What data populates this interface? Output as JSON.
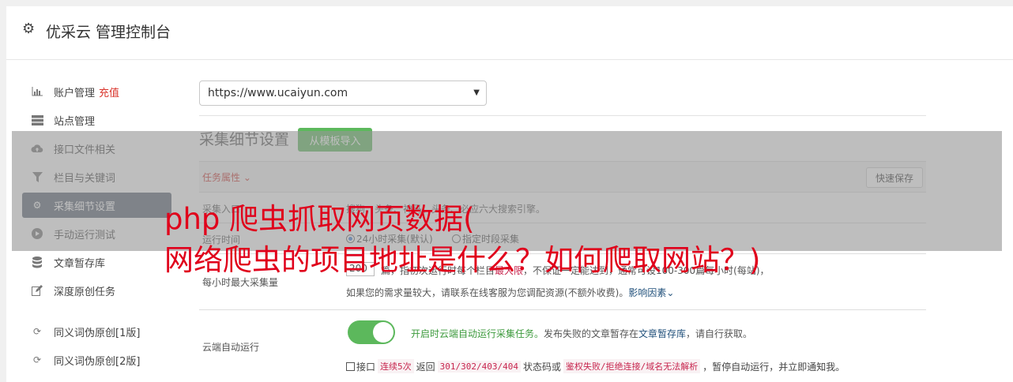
{
  "header": {
    "title": "优采云 管理控制台",
    "icon": "gear-icon"
  },
  "sidebar": {
    "items": [
      {
        "label": "账户管理",
        "badge": "充值",
        "icon": "bar-chart-icon"
      },
      {
        "label": "站点管理",
        "icon": "server-icon"
      },
      {
        "label": "接口文件相关",
        "icon": "cloud-upload-icon"
      },
      {
        "label": "栏目与关键词",
        "icon": "filter-icon"
      },
      {
        "label": "采集细节设置",
        "icon": "gears-icon",
        "active": true
      },
      {
        "label": "手动运行测试",
        "icon": "play-circle-icon"
      },
      {
        "label": "文章暂存库",
        "icon": "database-icon"
      },
      {
        "label": "深度原创任务",
        "icon": "edit-icon"
      },
      {
        "label": "同义词伪原创[1版]",
        "icon": "refresh-icon"
      },
      {
        "label": "同义词伪原创[2版]",
        "icon": "refresh-icon"
      }
    ]
  },
  "site_select": {
    "value": "https://www.ucaiyun.com"
  },
  "section": {
    "title": "采集细节设置",
    "template_button": "从模板导入"
  },
  "table": {
    "attr_label": "任务属性",
    "quick_save": "快速保存",
    "entry_label": "采集入口",
    "entry_value": "搜狗、头条、神马、头条、必应六大搜索引擎。",
    "time_label": "运行时间",
    "time_option_1": "24小时采集(默认)",
    "time_option_2": "指定时段采集",
    "max_label": "每小时最大采集量",
    "max_value": "200",
    "max_text_a": "篇，指初次运行时每个栏目",
    "max_text_pink": "最大限",
    "max_text_b": "，不保证一定能达到，通常可设100-300篇每小时(每站)，",
    "max_text_2": "如果您的需求量较大，请联系在线客服为您调配资源(不额外收费)。",
    "max_link": "影响因素",
    "cloud_label": "云端自动运行",
    "cloud_green": "开启时云端自动运行采集任务。",
    "cloud_text": "发布失败的文章暂存在",
    "cloud_link": "文章暂存库",
    "cloud_text_end": "，请自行获取。",
    "api_label": "接口",
    "code1": "连续5次",
    "ret_text": "返回",
    "code2": "301/302/403/404",
    "status_text": "状态码或",
    "code3": "鉴权失败/拒绝连接/域名无法解析",
    "stop_text": "，暂停自动运行，并立即通知我。"
  },
  "overlay_title": {
    "line1": "php 爬虫抓取网页数据(",
    "line2": "网络爬虫的项目地址是什么？如何爬取网站？)"
  }
}
